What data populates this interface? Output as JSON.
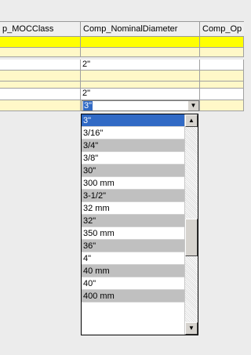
{
  "grid": {
    "columns": [
      "p_MOCClass",
      "Comp_NominalDiameter",
      "Comp_Op"
    ],
    "rows": [
      {
        "c1": "",
        "c2": "",
        "c3": ""
      },
      {
        "c1": "",
        "c2": "",
        "c3": ""
      },
      {
        "c1": "",
        "c2": "2\"",
        "c3": ""
      },
      {
        "c1": "",
        "c2": "",
        "c3": ""
      },
      {
        "c1": "",
        "c2": "",
        "c3": ""
      },
      {
        "c1": "",
        "c2": "2\"",
        "c3": ""
      }
    ],
    "editing_value": "3\""
  },
  "dropdown": {
    "selected": "3\"",
    "items": [
      "3\"",
      "3/16\"",
      "3/4\"",
      "3/8\"",
      "30\"",
      "300 mm",
      "3-1/2\"",
      "32 mm",
      "32\"",
      "350 mm",
      "36\"",
      "4\"",
      "40 mm",
      "40\"",
      "400 mm"
    ]
  },
  "icons": {
    "dropdown_arrow": "chevron-down-icon",
    "scroll_up": "arrow-up-icon",
    "scroll_down": "arrow-down-icon"
  }
}
